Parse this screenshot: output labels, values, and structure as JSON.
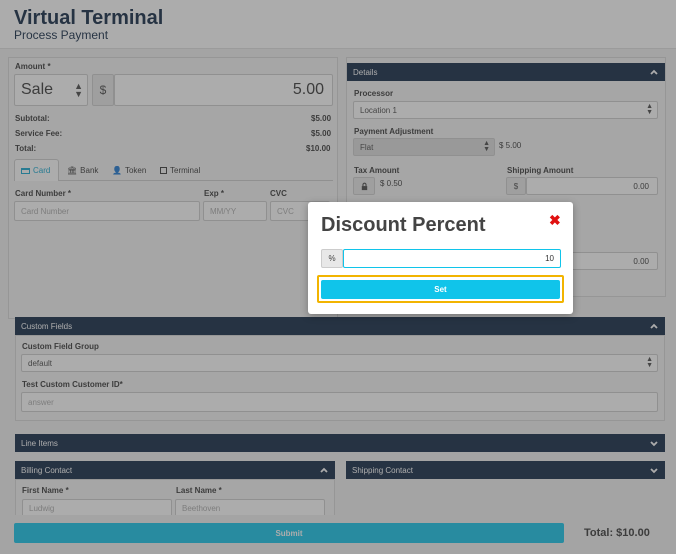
{
  "header": {
    "title": "Virtual Terminal",
    "subtitle": "Process Payment"
  },
  "amount": {
    "label": "Amount *",
    "type_value": "Sale",
    "currency_symbol": "$",
    "value": "5.00",
    "subtotal_label": "Subtotal:",
    "subtotal": "$5.00",
    "service_fee_label": "Service Fee:",
    "service_fee": "$5.00",
    "total_label": "Total:",
    "total": "$10.00"
  },
  "payment_tabs": [
    {
      "label": "Card",
      "icon": "card-icon",
      "active": true
    },
    {
      "label": "Bank",
      "icon": "bank-icon",
      "active": false
    },
    {
      "label": "Token",
      "icon": "user-icon",
      "active": false
    },
    {
      "label": "Terminal",
      "icon": "terminal-icon",
      "active": false
    }
  ],
  "card": {
    "number_label": "Card Number *",
    "number_placeholder": "Card Number",
    "exp_label": "Exp *",
    "exp_placeholder": "MM/YY",
    "cvc_label": "CVC",
    "cvc_placeholder": "CVC"
  },
  "details": {
    "title": "Details",
    "processor_label": "Processor",
    "processor_value": "Location 1",
    "adjustment_label": "Payment Adjustment",
    "adjustment_value": "Flat",
    "adjustment_amount": "$ 5.00",
    "tax_label": "Tax Amount",
    "tax_value": "$ 0.50",
    "shipping_label": "Shipping Amount",
    "shipping_symbol": "$",
    "shipping_value": "0.00",
    "other_value": "0.00"
  },
  "custom_fields": {
    "title": "Custom Fields",
    "group_label": "Custom Field Group",
    "group_value": "default",
    "customer_id_label": "Test Custom Customer ID*",
    "customer_id_placeholder": "answer"
  },
  "line_items": {
    "title": "Line Items"
  },
  "billing": {
    "title": "Billing Contact",
    "first_name_label": "First Name *",
    "first_name_placeholder": "Ludwig",
    "last_name_label": "Last Name *",
    "last_name_placeholder": "Beethoven"
  },
  "shipping_contact": {
    "title": "Shipping Contact"
  },
  "footer": {
    "submit_label": "Submit",
    "total_text": "Total: $10.00"
  },
  "modal": {
    "title": "Discount Percent",
    "prefix": "%",
    "value": "10",
    "set_label": "Set"
  },
  "colors": {
    "navy": "#0c2340",
    "accent": "#10c4ea",
    "focus_outline": "#f2b400",
    "close": "#e01010"
  }
}
